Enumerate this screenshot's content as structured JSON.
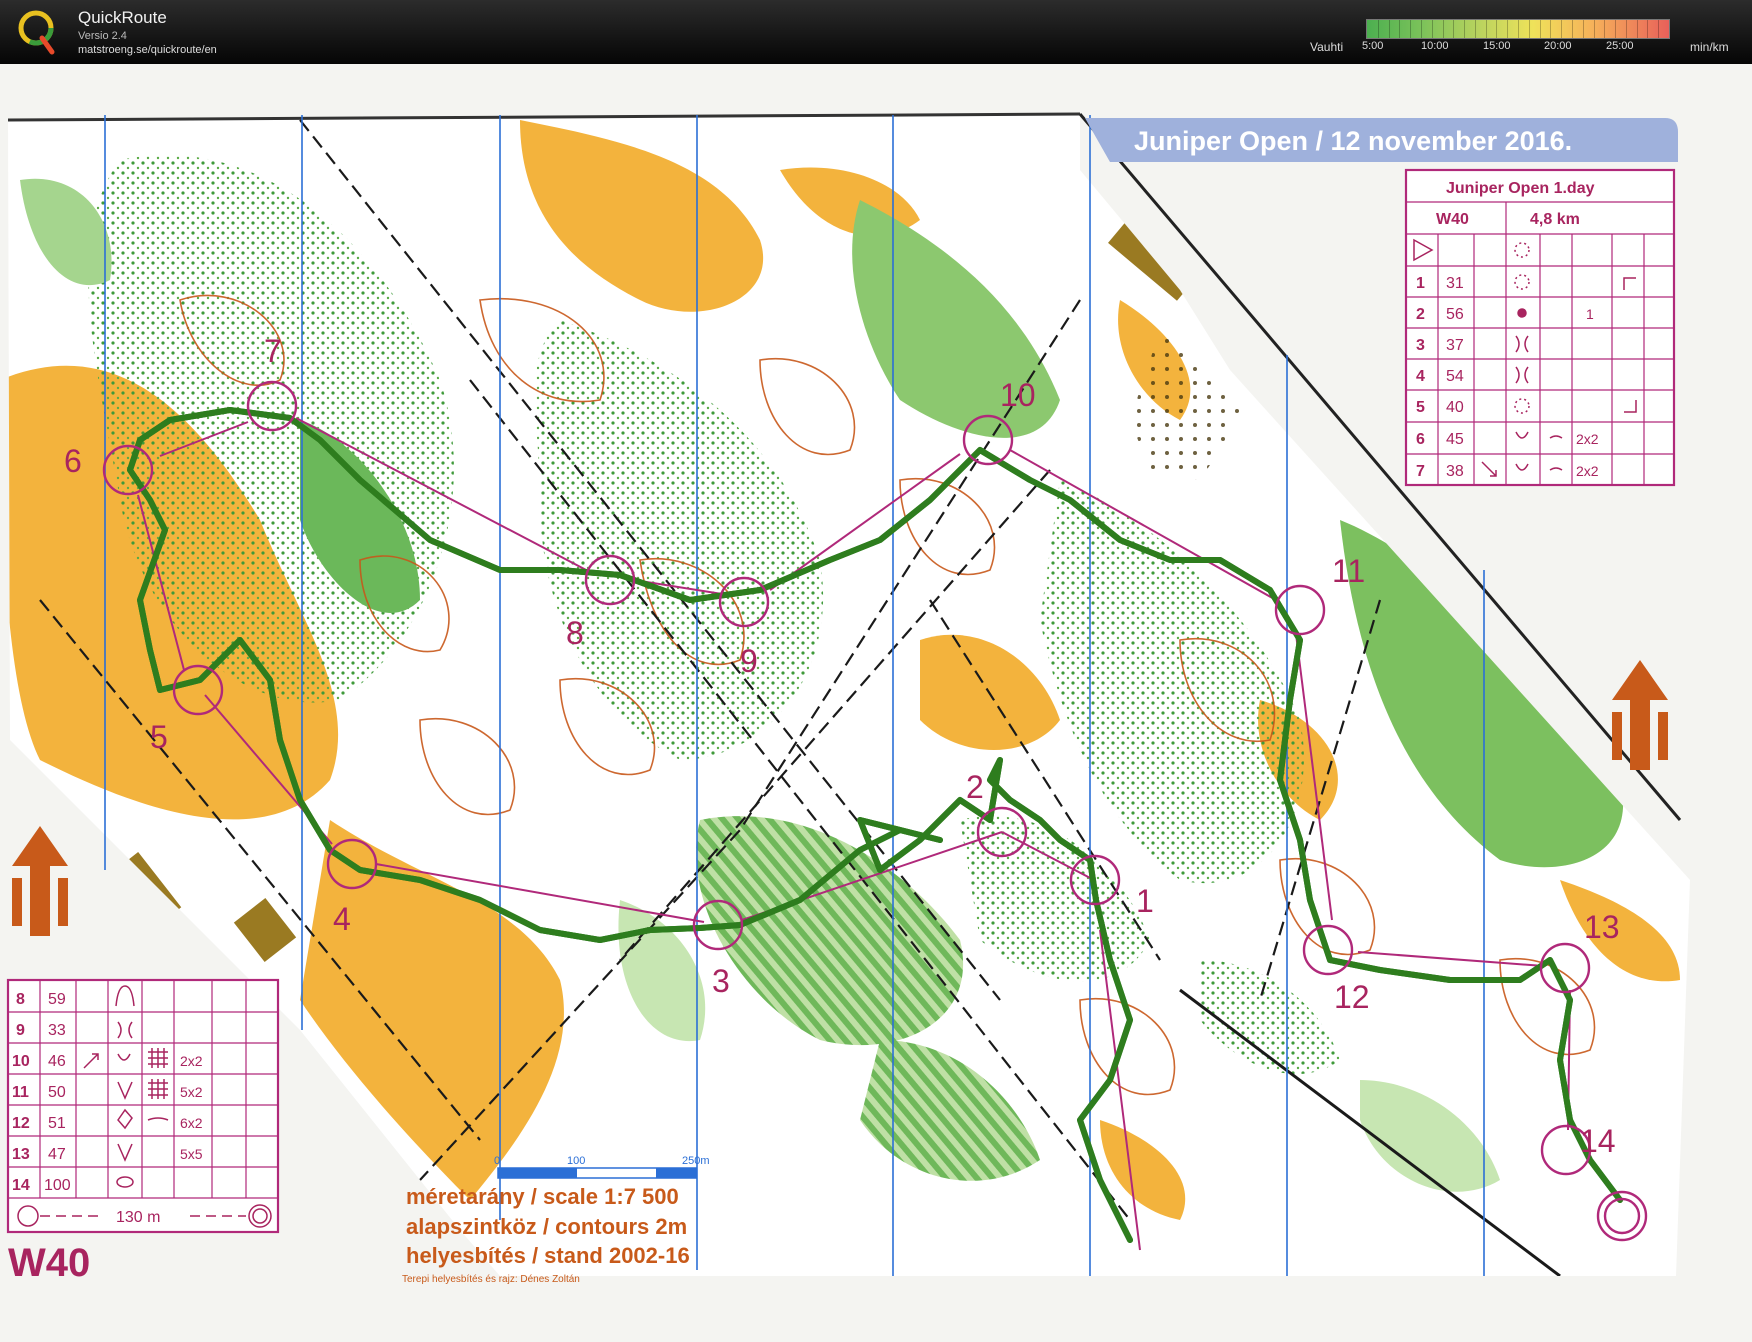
{
  "app": {
    "title": "QuickRoute",
    "version": "Versio 2.4",
    "url": "matstroeng.se/quickroute/en"
  },
  "pace_scale": {
    "label": "Vauhti",
    "ticks": [
      "5:00",
      "10:00",
      "15:00",
      "20:00",
      "25:00"
    ],
    "unit": "min/km"
  },
  "map": {
    "header": "Juniper Open  /  12 november 2016.",
    "class_label": "W40",
    "scale_line": "méretarány / scale   1:7 500",
    "contours_line": "alapszintköz / contours  2m",
    "stand_line": "helyesbítés / stand  2002-16",
    "credit": "Terepi helyesbítés és rajz: Dénes Zoltán",
    "scalebar_labels": [
      "0",
      "100",
      "250m"
    ],
    "control_labels": [
      "1",
      "2",
      "3",
      "4",
      "5",
      "6",
      "7",
      "8",
      "9",
      "10",
      "11",
      "12",
      "13",
      "14"
    ],
    "description_top": {
      "title": "Juniper Open 1.day",
      "class": "W40",
      "length": "4,8 km",
      "rows": [
        {
          "num": "1",
          "code": "31",
          "extra": ""
        },
        {
          "num": "2",
          "code": "56",
          "extra": "1"
        },
        {
          "num": "3",
          "code": "37",
          "extra": ""
        },
        {
          "num": "4",
          "code": "54",
          "extra": ""
        },
        {
          "num": "5",
          "code": "40",
          "extra": ""
        },
        {
          "num": "6",
          "code": "45",
          "extra": "2x2"
        },
        {
          "num": "7",
          "code": "38",
          "extra": "2x2"
        }
      ]
    },
    "description_bottom": {
      "rows": [
        {
          "num": "8",
          "code": "59",
          "extra": ""
        },
        {
          "num": "9",
          "code": "33",
          "extra": ""
        },
        {
          "num": "10",
          "code": "46",
          "extra": "2x2"
        },
        {
          "num": "11",
          "code": "50",
          "extra": "5x2"
        },
        {
          "num": "12",
          "code": "51",
          "extra": "6x2"
        },
        {
          "num": "13",
          "code": "47",
          "extra": "5x5"
        },
        {
          "num": "14",
          "code": "100",
          "extra": ""
        }
      ],
      "finish_text": "130 m"
    }
  }
}
